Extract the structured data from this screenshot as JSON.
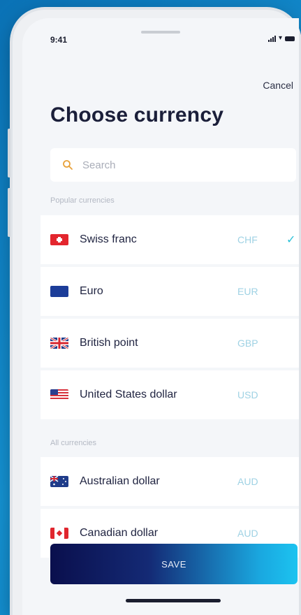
{
  "status_bar": {
    "time": "9:41"
  },
  "header": {
    "cancel_label": "Cancel",
    "title": "Choose currency"
  },
  "search": {
    "placeholder": "Search",
    "value": ""
  },
  "sections": {
    "popular_label": "Popular currencies",
    "all_label": "All currencies"
  },
  "popular_currencies": [
    {
      "name": "Swiss franc",
      "code": "CHF",
      "flag": "switzerland-flag",
      "selected": true
    },
    {
      "name": "Euro",
      "code": "EUR",
      "flag": "eu-flag",
      "selected": false
    },
    {
      "name": "British point",
      "code": "GBP",
      "flag": "uk-flag",
      "selected": false
    },
    {
      "name": "United States dollar",
      "code": "USD",
      "flag": "us-flag",
      "selected": false
    }
  ],
  "all_currencies": [
    {
      "name": "Australian dollar",
      "code": "AUD",
      "flag": "australia-flag"
    },
    {
      "name": "Canadian dollar",
      "code": "AUD",
      "flag": "canada-flag"
    }
  ],
  "selected_mark": "✓",
  "footer": {
    "save_label": "SAVE"
  },
  "colors": {
    "background": "#1592d2",
    "title": "#1b1f3a",
    "code_text": "#9fd2e4",
    "check": "#2cc1d8",
    "save_gradient_start": "#0a0f4d",
    "save_gradient_end": "#1cc3f0"
  }
}
